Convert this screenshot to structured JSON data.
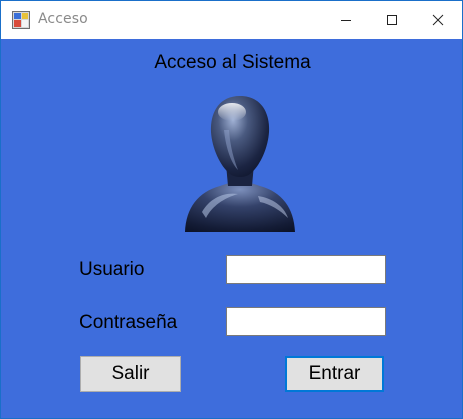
{
  "window": {
    "title": "Acceso",
    "controls": [
      "minimize-icon",
      "maximize-icon",
      "close-icon"
    ]
  },
  "form": {
    "heading": "Acceso al Sistema",
    "avatar_icon": "user-silhouette-icon",
    "usuario_label": "Usuario",
    "usuario_value": "",
    "contrasena_label": "Contraseña",
    "contrasena_value": "",
    "salir_label": "Salir",
    "entrar_label": "Entrar"
  },
  "colors": {
    "background": "#3e6ddc",
    "default_button_border": "#0078d7"
  }
}
